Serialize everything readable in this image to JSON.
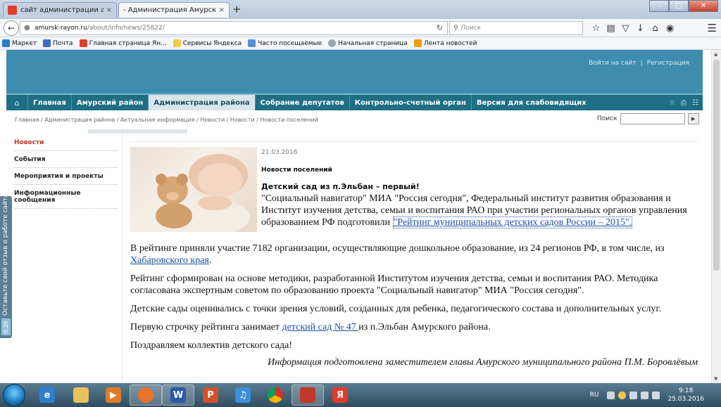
{
  "browser": {
    "tabs": [
      {
        "title": "сайт администрации аму...",
        "close": "×",
        "active": false
      },
      {
        "title": "- Администрация Амурского ...",
        "close": "×",
        "active": true
      }
    ],
    "new_tab": "+",
    "window_buttons": {
      "minimize": "–",
      "maximize": "□",
      "close": "✕"
    },
    "address": {
      "domain": "amursk-rayon.ru",
      "path": "/about/info/news/25822/"
    },
    "search_placeholder": "Поиск",
    "bookmarks": [
      "Маркет",
      "Почта",
      "Главная страница Ян...",
      "Сервисы Яндекса",
      "Часто посещаемые",
      "Начальная страница",
      "Лента новостей"
    ]
  },
  "site": {
    "auth": {
      "login": "Войти на сайт",
      "separator": "|",
      "register": "Регистрация"
    },
    "nav": [
      {
        "label": "Главная",
        "active": false
      },
      {
        "label": "Амурский район",
        "active": false
      },
      {
        "label": "Администрация района",
        "active": true
      },
      {
        "label": "Собрание депутатов",
        "active": false
      },
      {
        "label": "Контрольно-счетный орган",
        "active": false
      },
      {
        "label": "Версия для слабовидящих",
        "active": false
      }
    ],
    "breadcrumb": "Главная / Администрация района / Актуальная информация / Новости / Новости / Новости поселений",
    "search_label": "Поиск",
    "search_go": "▶",
    "feedback": {
      "text": "Оставьте свой отзыв о работе сайта",
      "count": "0.20"
    },
    "sidebar": [
      {
        "label": "Новости",
        "active": true
      },
      {
        "label": "События",
        "active": false
      },
      {
        "label": "Мероприятия и проекты",
        "active": false
      },
      {
        "label": "Информационные сообщения",
        "active": false
      }
    ]
  },
  "article": {
    "date": "21.03.2016",
    "category": "Новости поселений",
    "headline": "Детский сад из п.Эльбан – первый!",
    "p1_text": "\"Социальный навигатор\" МИА \"Россия сегодня\", Федеральный институт развития образования и Институт изучения детства, семьи и воспитания РАО при участии региональных органов управления образованием РФ подготовили ",
    "p1_link": "\"Рейтинг муниципальных детских садов России – 2015\".",
    "p2_text": "В рейтинге приняли участие 7182 организации, осуществляющие дошкольное образование, из 24 регионов РФ, в том числе, из ",
    "p2_link": "Хабаровского края",
    "p2_end": ".",
    "p3": "Рейтинг сформирован на основе методики, разработанной Институтом изучения детства, семьи и воспитания РАО. Методика согласована экспертным советом по образованию проекта \"Социальный навигатор\" МИА \"Россия сегодня\".",
    "p4": "Детские сады оценивались с точки зрения условий, созданных для ребенка, педагогического состава и дополнительных услуг.",
    "p5_start": "Первую строчку рейтинга занимает ",
    "p5_link": "детский сад № 47 ",
    "p5_end": "из п.Эльбан Амурского района.",
    "p6": "Поздравляем коллектив детского сада!",
    "signature": "Информация подготовлена заместителем главы Амурского муниципального района П.М. Боровлёвым"
  },
  "taskbar": {
    "apps": [
      "ie-icon",
      "explorer-icon",
      "media-player-icon",
      "firefox-icon",
      "word-icon",
      "powerpoint-icon",
      "audio-icon",
      "chrome-icon",
      "presentation-icon",
      "yandex-icon"
    ],
    "lang": "RU",
    "time": "9:18",
    "date": "25.03.2016"
  },
  "colors": {
    "banner": "#3e8daf",
    "nav": "#1e6f86",
    "link": "#1a4fa3",
    "active_sidebar": "#c0392b"
  }
}
